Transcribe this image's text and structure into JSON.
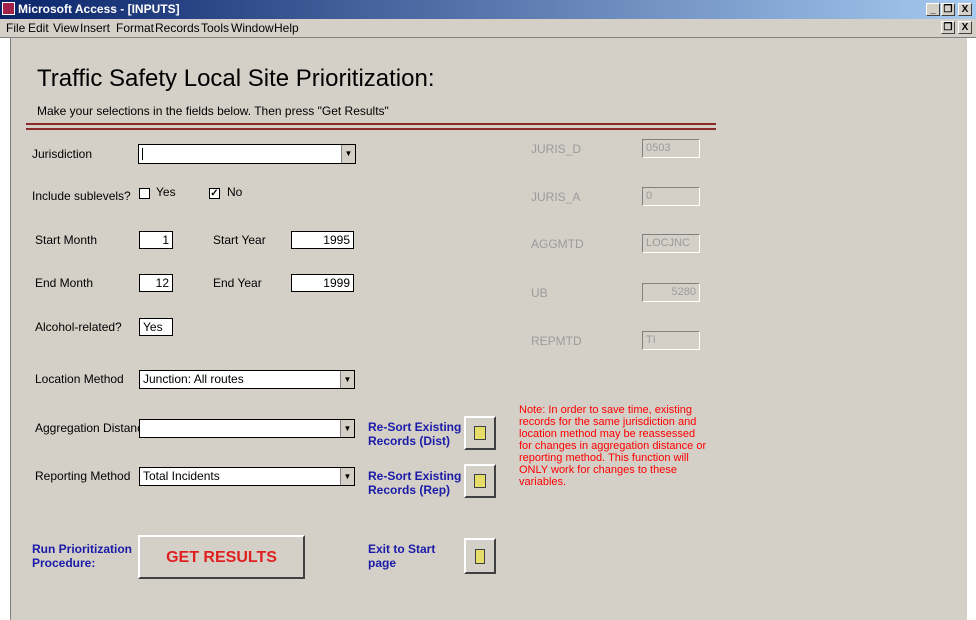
{
  "window": {
    "title": "Microsoft Access - [INPUTS]",
    "minimize": "_",
    "restore": "❐",
    "close": "X"
  },
  "menu": [
    {
      "label": "File"
    },
    {
      "label": "Edit"
    },
    {
      "label": "View"
    },
    {
      "label": "Insert"
    },
    {
      "label": "Format"
    },
    {
      "label": "Records"
    },
    {
      "label": "Tools"
    },
    {
      "label": "Window"
    },
    {
      "label": "Help"
    }
  ],
  "form": {
    "title": "Traffic Safety Local Site Prioritization:",
    "subtitle": "Make your selections in the fields below.  Then press \"Get Results\"",
    "jurisdiction": {
      "label": "Jurisdiction",
      "value": ""
    },
    "sublevels": {
      "label": "Include sublevels?",
      "yes": "Yes",
      "no": "No",
      "yes_checked": false,
      "no_checked": true
    },
    "start_month": {
      "label": "Start Month",
      "value": "1"
    },
    "start_year": {
      "label": "Start Year",
      "value": "1995"
    },
    "end_month": {
      "label": "End Month",
      "value": "12"
    },
    "end_year": {
      "label": "End Year",
      "value": "1999"
    },
    "alcohol": {
      "label": "Alcohol-related?",
      "value": "Yes"
    },
    "location_method": {
      "label": "Location Method",
      "value": "Junction: All routes"
    },
    "aggregation_distance": {
      "label": "Aggregation Distance",
      "value": ""
    },
    "reporting_method": {
      "label": "Reporting Method",
      "value": "Total Incidents"
    },
    "resort_dist": "Re-Sort Existing Records (Dist)",
    "resort_rep": "Re-Sort Existing Records (Rep)",
    "run_label": "Run Prioritization Procedure:",
    "get_results": "GET RESULTS",
    "exit_label": "Exit to Start page",
    "note": "Note:  In order to save time, existing records for the same jurisdiction and location method may be reassessed for changes in aggregation distance or reporting method.  This function will ONLY work for changes to these variables."
  },
  "hidden_fields": [
    {
      "label": "JURIS_D",
      "value": "0503"
    },
    {
      "label": "JURIS_A",
      "value": "0"
    },
    {
      "label": "AGGMTD",
      "value": "LOCJNC"
    },
    {
      "label": "UB",
      "value": "5280"
    },
    {
      "label": "REPMTD",
      "value": "TI"
    }
  ],
  "colors": {
    "rule": "#8b2a2a",
    "note": "#ff0000",
    "label_blue": "#1a1aa8",
    "get_results": "#e02020"
  }
}
